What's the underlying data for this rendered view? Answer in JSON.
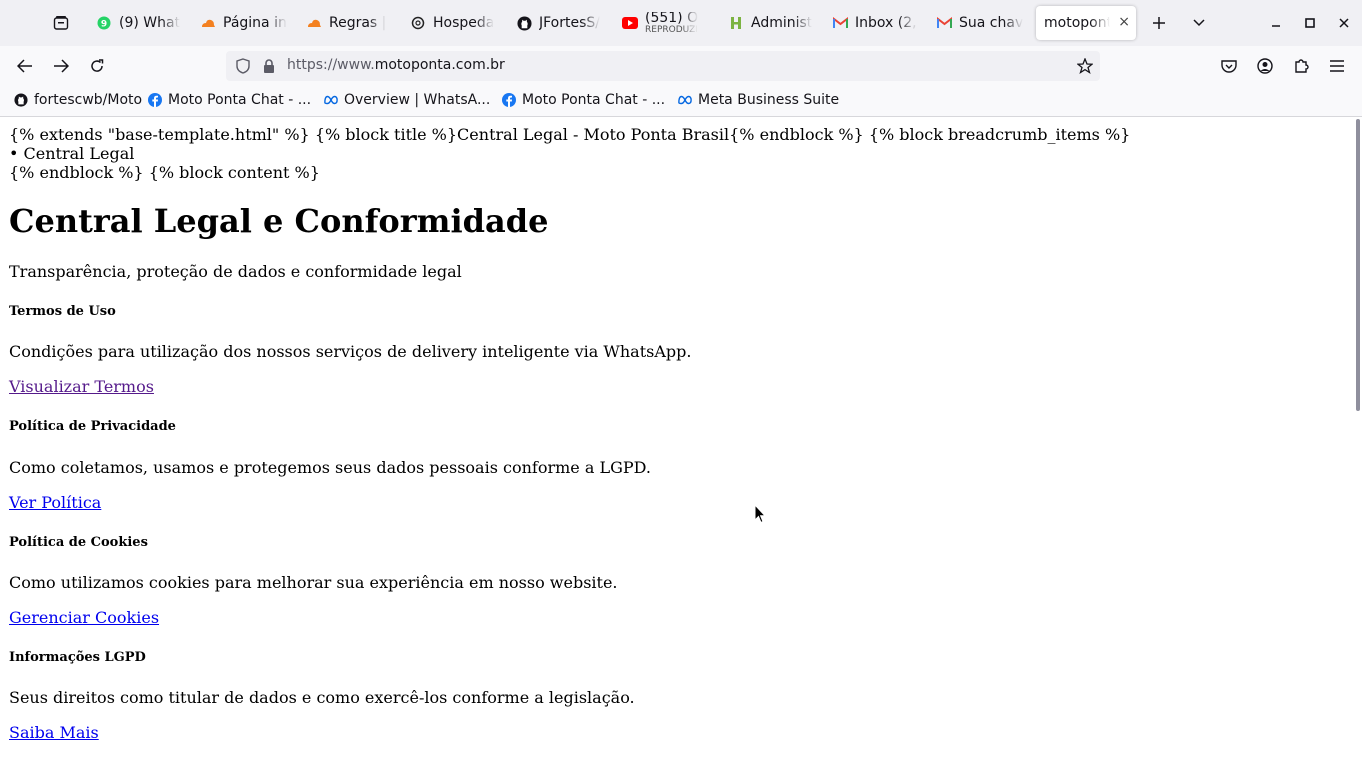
{
  "tabs": [
    {
      "label": "(9) What",
      "icon": "whatsapp-icon",
      "color": "#25d366"
    },
    {
      "label": "Página in",
      "icon": "cloudflare-icon",
      "color": "#f38020"
    },
    {
      "label": "Regras | ",
      "icon": "cloudflare-icon",
      "color": "#f38020"
    },
    {
      "label": "Hospeda",
      "icon": "openai-icon",
      "color": "#222222"
    },
    {
      "label": "JFortesS/",
      "icon": "github-icon",
      "color": "#15141a"
    },
    {
      "label": "(551) O ",
      "sub": "REPRODUZI",
      "icon": "youtube-icon",
      "color": "#ff0000"
    },
    {
      "label": "Administ",
      "icon": "hostinger-icon",
      "color": "#7cb342"
    },
    {
      "label": "Inbox (2,",
      "icon": "gmail-icon",
      "color": "#ea4335"
    },
    {
      "label": "Sua chav",
      "icon": "gmail-icon",
      "color": "#ea4335"
    }
  ],
  "active_tab": {
    "label": "motoponta",
    "close": "×"
  },
  "url": {
    "prefix": "https://www.",
    "domain": "motoponta.com.br"
  },
  "bookmarks": [
    {
      "label": "fortescwb/Moto",
      "icon": "github-icon"
    },
    {
      "label": "Moto Ponta Chat - ...",
      "icon": "facebook-icon"
    },
    {
      "label": "Overview | WhatsA...",
      "icon": "meta-icon"
    },
    {
      "label": "Moto Ponta Chat - ...",
      "icon": "facebook-icon"
    },
    {
      "label": "Meta Business Suite",
      "icon": "meta-icon"
    }
  ],
  "page": {
    "raw_line1": "{% extends \"base-template.html\" %} {% block title %}Central Legal - Moto Ponta Brasil{% endblock %} {% block breadcrumb_items %}",
    "raw_line2": "• Central Legal",
    "raw_line3": "{% endblock %} {% block content %}",
    "title": "Central Legal e Conformidade",
    "subtitle": "Transparência, proteção de dados e conformidade legal",
    "sections": [
      {
        "heading": "Termos de Uso",
        "text": "Condições para utilização dos nossos serviços de delivery inteligente via WhatsApp.",
        "link": "Visualizar Termos"
      },
      {
        "heading": "Política de Privacidade",
        "text": "Como coletamos, usamos e protegemos seus dados pessoais conforme a LGPD.",
        "link": "Ver Política"
      },
      {
        "heading": "Política de Cookies",
        "text": "Como utilizamos cookies para melhorar sua experiência em nosso website.",
        "link": "Gerenciar Cookies"
      },
      {
        "heading": "Informações LGPD",
        "text": "Seus direitos como titular de dados e como exercê-los conforme a legislação.",
        "link": "Saiba Mais"
      }
    ]
  },
  "colors": {
    "link": "#0000ee",
    "visited_link": "#551a8b"
  }
}
